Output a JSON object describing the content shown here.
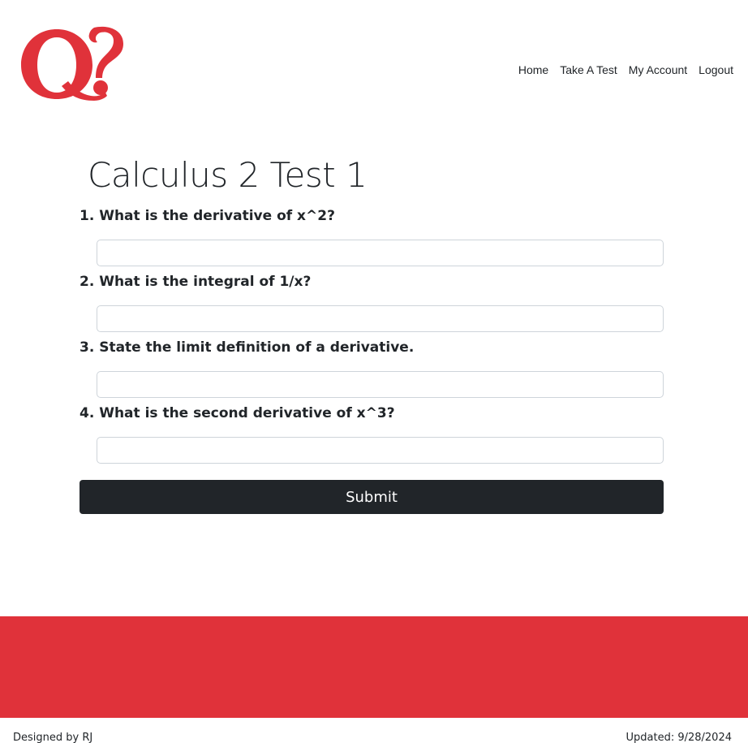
{
  "brand": {
    "logo_text": "Q?",
    "accent_color": "#e0323a"
  },
  "nav": {
    "items": [
      {
        "label": "Home"
      },
      {
        "label": "Take A Test"
      },
      {
        "label": "My Account"
      },
      {
        "label": "Logout"
      }
    ]
  },
  "test": {
    "title": "Calculus 2 Test 1",
    "questions": [
      {
        "label": "1. What is the derivative of x^2?",
        "value": ""
      },
      {
        "label": "2. What is the integral of 1/x?",
        "value": ""
      },
      {
        "label": "3. State the limit definition of a derivative.",
        "value": ""
      },
      {
        "label": "4. What is the second derivative of x^3?",
        "value": ""
      }
    ],
    "submit_label": "Submit"
  },
  "footer": {
    "designed_by": "Designed by RJ",
    "updated": "Updated: 9/28/2024"
  }
}
